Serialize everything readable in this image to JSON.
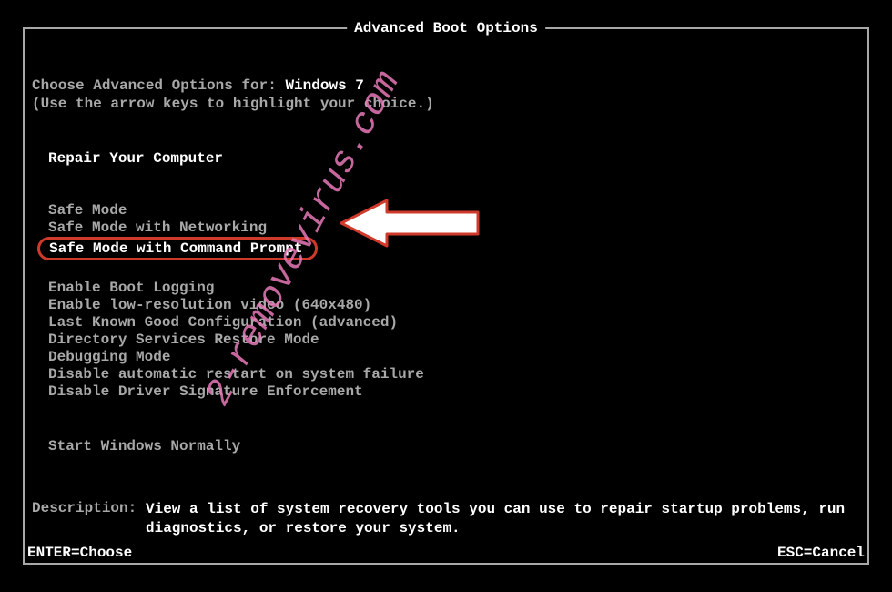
{
  "title": "Advanced Boot Options",
  "choose": {
    "label": "Choose Advanced Options for: ",
    "os": "Windows 7",
    "hint": "(Use the arrow keys to highlight your choice.)"
  },
  "highlighted_item": "Repair Your Computer",
  "group_safe": {
    "item1": "Safe Mode",
    "item2": "Safe Mode with Networking",
    "item3": "Safe Mode with Command Prompt"
  },
  "group_misc": {
    "item1": "Enable Boot Logging",
    "item2": "Enable low-resolution video (640x480)",
    "item3": "Last Known Good Configuration (advanced)",
    "item4": "Directory Services Restore Mode",
    "item5": "Debugging Mode",
    "item6": "Disable automatic restart on system failure",
    "item7": "Disable Driver Signature Enforcement"
  },
  "start_normal": "Start Windows Normally",
  "description": {
    "label": "Description:",
    "text": "View a list of system recovery tools you can use to repair startup problems, run diagnostics, or restore your system."
  },
  "footer": {
    "enter": "ENTER=Choose",
    "esc": "ESC=Cancel"
  },
  "watermark": "2-removevirus.com",
  "annotation": {
    "circled_item": "Safe Mode with Command Prompt",
    "arrow_color": "#ffffff",
    "arrow_stroke": "#d03a2b",
    "circle_color": "#d03a2b"
  }
}
